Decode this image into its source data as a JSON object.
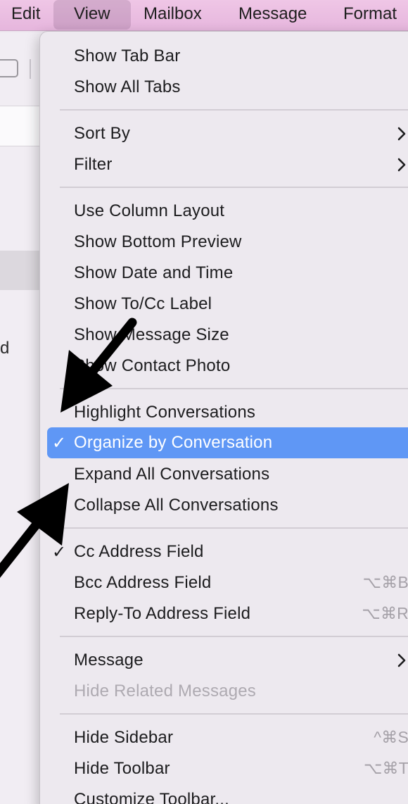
{
  "menubar": {
    "items": [
      "Edit",
      "View",
      "Mailbox",
      "Message",
      "Format"
    ],
    "active_index": 1
  },
  "background": {
    "fragment_text": "d"
  },
  "view_menu": {
    "group1": {
      "show_tab_bar": "Show Tab Bar",
      "show_all_tabs": "Show All Tabs"
    },
    "group2": {
      "sort_by": "Sort By",
      "filter": "Filter"
    },
    "group3": {
      "use_column_layout": "Use Column Layout",
      "show_bottom_preview": "Show Bottom Preview",
      "show_date_and_time": "Show Date and Time",
      "show_to_cc_label": "Show To/Cc Label",
      "show_message_size": "Show Message Size",
      "show_contact_photo": "Show Contact Photo"
    },
    "group4": {
      "highlight_conversations": "Highlight Conversations",
      "organize_by_conversation": "Organize by Conversation",
      "expand_all_conversations": "Expand All Conversations",
      "collapse_all_conversations": "Collapse All Conversations"
    },
    "group5": {
      "cc_address_field": "Cc Address Field",
      "bcc_address_field": "Bcc Address Field",
      "bcc_shortcut": "⌥⌘B",
      "reply_to_address_field": "Reply-To Address Field",
      "reply_to_shortcut": "⌥⌘R"
    },
    "group6": {
      "message": "Message",
      "hide_related_messages": "Hide Related Messages"
    },
    "group7": {
      "hide_sidebar": "Hide Sidebar",
      "hide_sidebar_shortcut": "^⌘S",
      "hide_toolbar": "Hide Toolbar",
      "hide_toolbar_shortcut": "⌥⌘T",
      "customize_toolbar": "Customize Toolbar..."
    },
    "check_glyph": "✓"
  },
  "colors": {
    "menubar": "#e6b6dd",
    "menu_bg": "#ede9ef",
    "highlight": "#5f97f5",
    "disabled_text": "#aeaab1",
    "arrow": "#000000"
  },
  "icons": [
    "chevron-right-icon",
    "checkmark-icon",
    "annotation-arrow"
  ]
}
